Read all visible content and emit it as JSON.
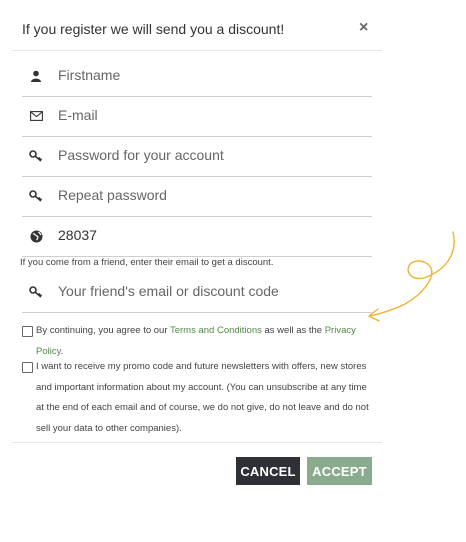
{
  "modal": {
    "title": "If you register we will send you a discount!",
    "close_label": "×"
  },
  "fields": {
    "firstname": {
      "placeholder": "Firstname",
      "icon": "user-icon"
    },
    "email": {
      "placeholder": "E-mail",
      "icon": "envelope-icon"
    },
    "password": {
      "placeholder": "Password for your account",
      "icon": "key-icon"
    },
    "repeat_password": {
      "placeholder": "Repeat password",
      "icon": "key-icon"
    },
    "postcode": {
      "value": "28037",
      "icon": "globe-icon"
    },
    "friend_code": {
      "placeholder": "Your friend's email or discount code",
      "icon": "key-icon"
    }
  },
  "hint": "If you come from a friend, enter their email to get a discount.",
  "terms": {
    "before": "By continuing, you agree to our ",
    "terms_link": "Terms and Conditions",
    "middle": " as well as the ",
    "privacy_link": "Privacy Policy",
    "after": "."
  },
  "newsletter": {
    "text": "I want to receive my promo code and future newsletters with offers, new stores and important information about my account. (You can unsubscribe at any time at the end of each email and of course, we do not give, do not leave and do not sell your data to other companies)."
  },
  "buttons": {
    "cancel": "CANCEL",
    "accept": "ACCEPT"
  },
  "colors": {
    "accent_green": "#4f8a45",
    "accept_bg": "#8aab8e",
    "cancel_bg": "#2d3035",
    "doodle": "#f2b233"
  }
}
